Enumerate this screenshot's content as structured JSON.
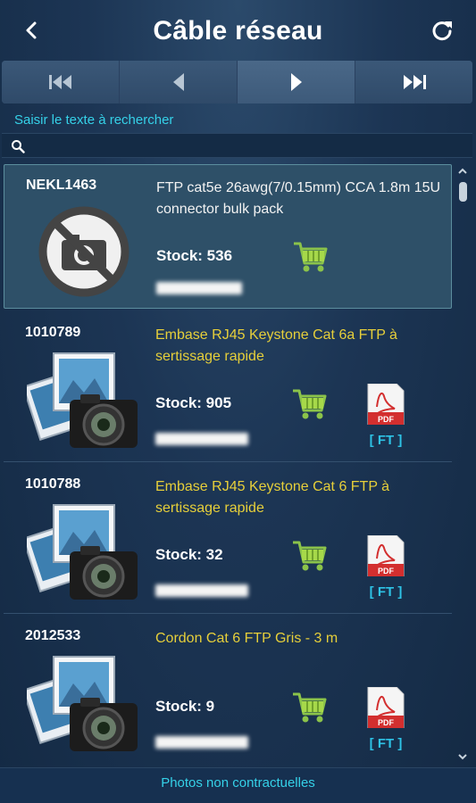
{
  "header": {
    "title": "Câble réseau",
    "back_icon": "chevron-left-icon",
    "refresh_icon": "refresh-icon"
  },
  "pager": {
    "buttons": [
      "first-page-icon",
      "previous-page-icon",
      "next-page-icon",
      "last-page-icon"
    ],
    "active_index": 2
  },
  "search": {
    "label": "Saisir le texte à rechercher",
    "value": "",
    "icon": "search-icon"
  },
  "products": [
    {
      "ref": "NEKL1463",
      "description": "FTP cat5e 26awg(7/0.15mm) CCA 1.8m 15U connector bulk pack",
      "stock": "Stock: 536",
      "image": "no-photo-icon",
      "has_datasheet": false,
      "selected": true
    },
    {
      "ref": "1010789",
      "description": "Embase RJ45 Keystone Cat 6a FTP à sertissage rapide",
      "stock": "Stock: 905",
      "image": "camera-photo-icon",
      "has_datasheet": true,
      "datasheet_label": "[ FT ]"
    },
    {
      "ref": "1010788",
      "description": "Embase RJ45 Keystone Cat 6 FTP à sertissage rapide",
      "stock": "Stock: 32",
      "image": "camera-photo-icon",
      "has_datasheet": true,
      "datasheet_label": "[ FT ]"
    },
    {
      "ref": "2012533",
      "description": "Cordon Cat 6 FTP Gris - 3 m",
      "stock": "Stock: 9",
      "image": "camera-photo-icon",
      "has_datasheet": true,
      "datasheet_label": "[ FT ]"
    }
  ],
  "footer": {
    "text": "Photos non contractuelles"
  },
  "colors": {
    "accent_cyan": "#35d1e8",
    "cart_green": "#8bc34a",
    "title_yellow": "#e6cf3a",
    "pdf_red": "#d32f2f"
  }
}
